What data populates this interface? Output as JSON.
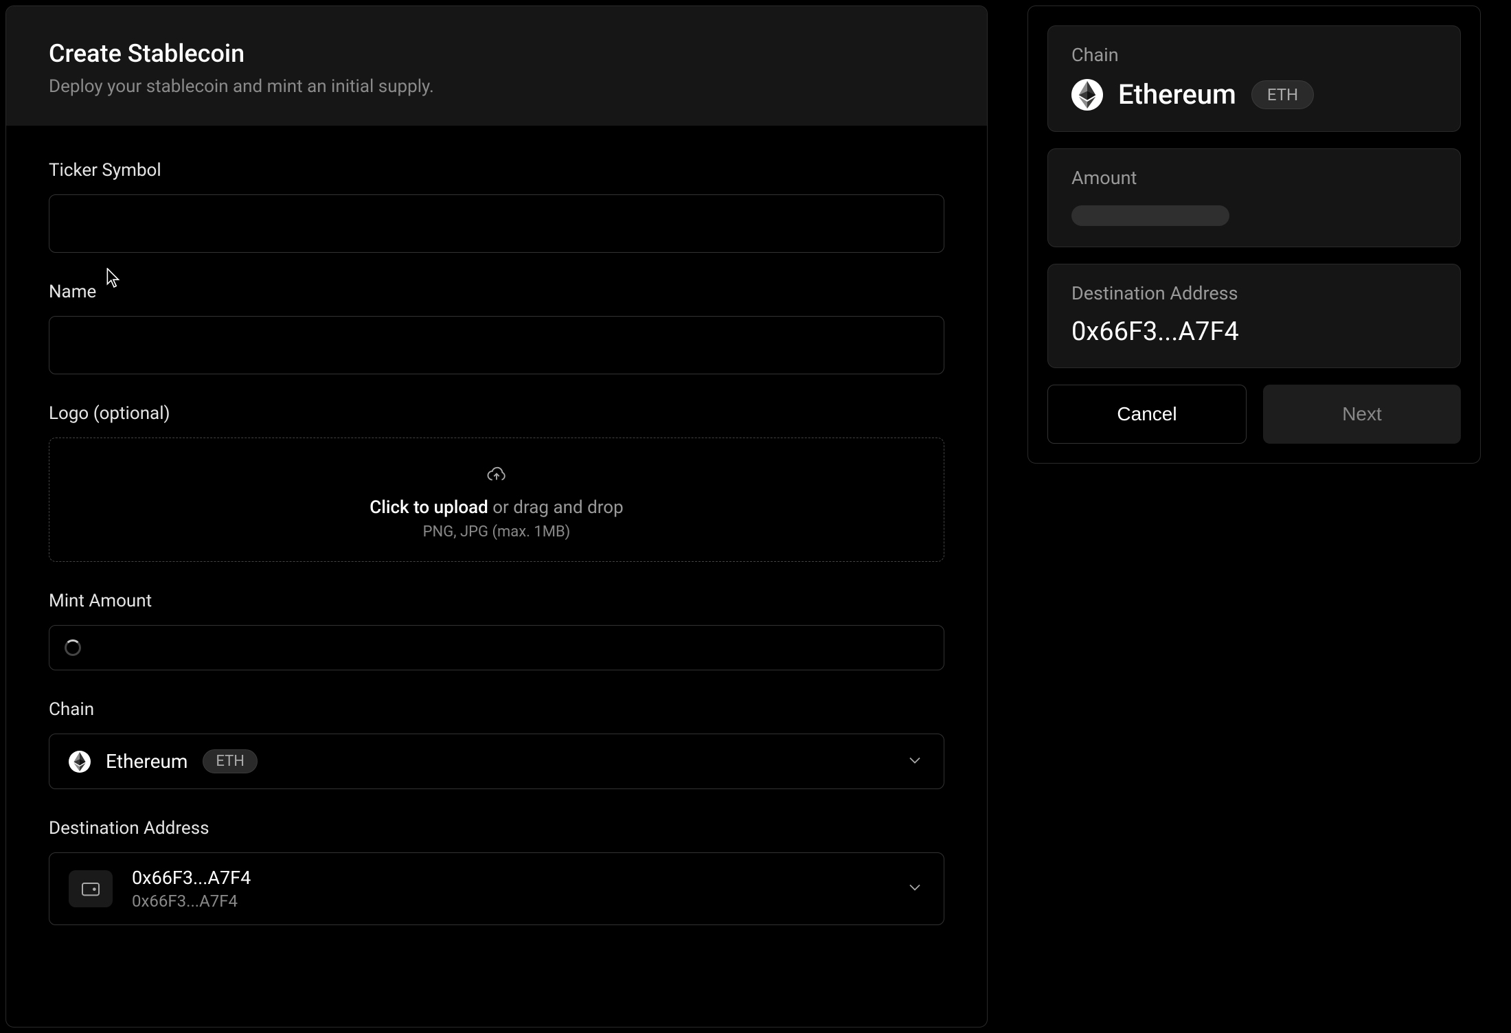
{
  "header": {
    "title": "Create Stablecoin",
    "subtitle": "Deploy your stablecoin and mint an initial supply."
  },
  "form": {
    "ticker": {
      "label": "Ticker Symbol",
      "value": ""
    },
    "name": {
      "label": "Name",
      "value": ""
    },
    "logo": {
      "label": "Logo (optional)",
      "upload_bold": "Click to upload",
      "upload_rest": " or drag and drop",
      "hint": "PNG, JPG (max. 1MB)"
    },
    "mint_amount": {
      "label": "Mint Amount",
      "value": ""
    },
    "chain": {
      "label": "Chain",
      "name": "Ethereum",
      "badge": "ETH"
    },
    "destination": {
      "label": "Destination Address",
      "address": "0x66F3...A7F4",
      "address_sub": "0x66F3...A7F4"
    }
  },
  "summary": {
    "chain": {
      "label": "Chain",
      "name": "Ethereum",
      "badge": "ETH"
    },
    "amount": {
      "label": "Amount"
    },
    "destination": {
      "label": "Destination Address",
      "address": "0x66F3...A7F4"
    }
  },
  "buttons": {
    "cancel": "Cancel",
    "next": "Next"
  }
}
